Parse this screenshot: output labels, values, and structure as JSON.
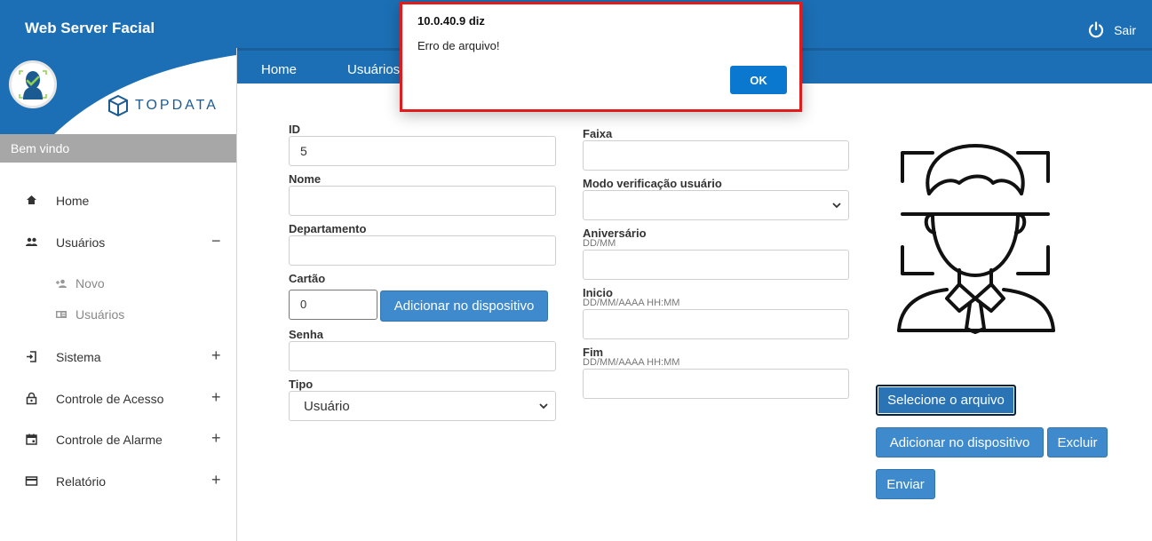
{
  "header": {
    "app_title": "Web Server Facial",
    "logout_label": "Sair",
    "bg_color": "#1c6fb5"
  },
  "sidebar": {
    "brand_name": "TOPDATA",
    "welcome": "Bem vindo",
    "items": [
      {
        "label": "Home",
        "icon": "home-icon",
        "toggle": ""
      },
      {
        "label": "Usuários",
        "icon": "users-icon",
        "toggle": "−"
      },
      {
        "label": "Novo",
        "icon": "add-user-icon",
        "sub": true
      },
      {
        "label": "Usuários",
        "icon": "id-card-icon",
        "sub": true
      },
      {
        "label": "Sistema",
        "icon": "login-icon",
        "toggle": "+"
      },
      {
        "label": "Controle de Acesso",
        "icon": "lock-icon",
        "toggle": "+"
      },
      {
        "label": "Controle de Alarme",
        "icon": "calendar-icon",
        "toggle": "+"
      },
      {
        "label": "Relatório",
        "icon": "card-icon",
        "toggle": "+"
      }
    ]
  },
  "navbar": {
    "tabs": [
      "Home",
      "Usuários"
    ]
  },
  "form": {
    "id": {
      "label": "ID",
      "value": "5"
    },
    "nome": {
      "label": "Nome",
      "value": ""
    },
    "departamento": {
      "label": "Departamento",
      "value": ""
    },
    "cartao": {
      "label": "Cartão",
      "value": "0",
      "button": "Adicionar no dispositivo"
    },
    "senha": {
      "label": "Senha",
      "value": ""
    },
    "tipo": {
      "label": "Tipo",
      "selected": "Usuário"
    },
    "faixa": {
      "label": "Faixa",
      "value": ""
    },
    "modo": {
      "label": "Modo verificação usuário",
      "selected": ""
    },
    "aniversario": {
      "label": "Aniversário",
      "hint": "DD/MM",
      "value": ""
    },
    "inicio": {
      "label": "Inicio",
      "hint": "DD/MM/AAAA HH:MM",
      "value": ""
    },
    "fim": {
      "label": "Fim",
      "hint": "DD/MM/AAAA HH:MM",
      "value": ""
    }
  },
  "photo": {
    "select_button": "Selecione o arquivo",
    "add_button": "Adicionar no dispositivo",
    "delete_button": "Excluir",
    "send_button": "Enviar"
  },
  "dialog": {
    "title": "10.0.40.9 diz",
    "message": "Erro de arquivo!",
    "ok_label": "OK",
    "border_color": "#e01c1c"
  }
}
